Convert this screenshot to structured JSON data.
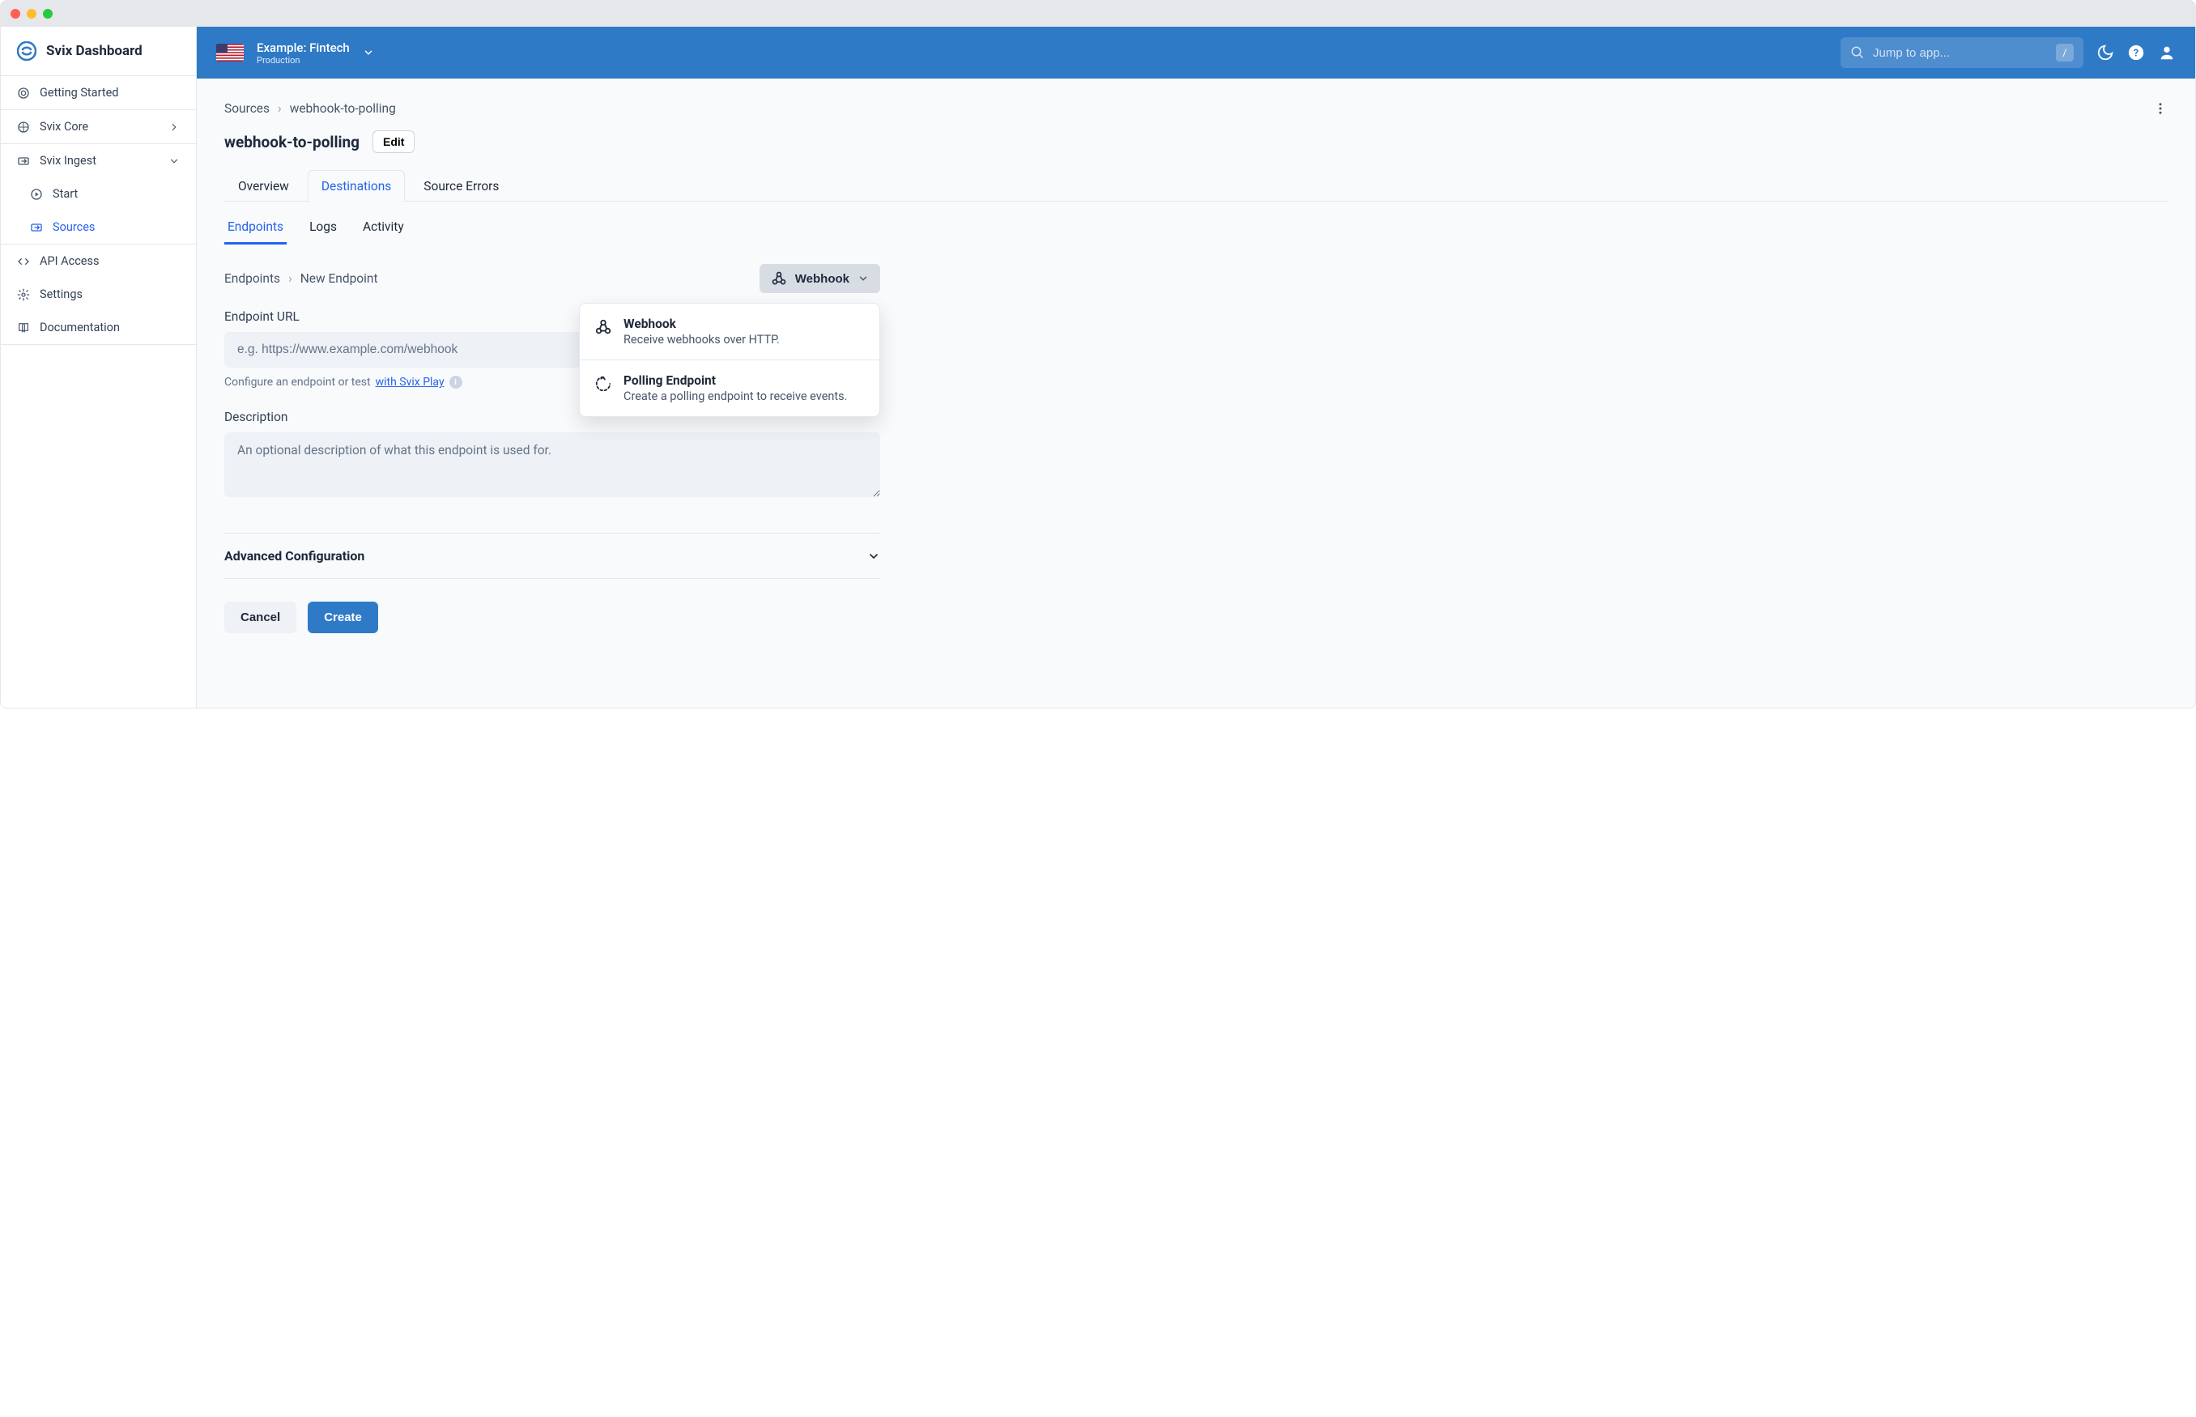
{
  "brand": "Svix Dashboard",
  "sidebar": {
    "getting_started": "Getting Started",
    "svix_core": "Svix Core",
    "svix_ingest": "Svix Ingest",
    "start": "Start",
    "sources": "Sources",
    "api_access": "API Access",
    "settings": "Settings",
    "documentation": "Documentation"
  },
  "topbar": {
    "env_name": "Example: Fintech",
    "env_stage": "Production",
    "search_placeholder": "Jump to app...",
    "kbd": "/"
  },
  "breadcrumbs": {
    "root": "Sources",
    "current": "webhook-to-polling"
  },
  "page": {
    "title": "webhook-to-polling",
    "edit": "Edit"
  },
  "tabs_primary": {
    "overview": "Overview",
    "destinations": "Destinations",
    "source_errors": "Source Errors"
  },
  "tabs_secondary": {
    "endpoints": "Endpoints",
    "logs": "Logs",
    "activity": "Activity"
  },
  "sub_breadcrumbs": {
    "root": "Endpoints",
    "current": "New Endpoint"
  },
  "type_selector": {
    "selected": "Webhook",
    "options": [
      {
        "title": "Webhook",
        "desc": "Receive webhooks over HTTP."
      },
      {
        "title": "Polling Endpoint",
        "desc": "Create a polling endpoint to receive events."
      }
    ]
  },
  "form": {
    "url_label": "Endpoint URL",
    "url_placeholder": "e.g. https://www.example.com/webhook",
    "helper_prefix": "Configure an endpoint or test ",
    "helper_link": "with Svix Play",
    "desc_label": "Description",
    "desc_placeholder": "An optional description of what this endpoint is used for.",
    "advanced": "Advanced Configuration",
    "cancel": "Cancel",
    "create": "Create"
  }
}
